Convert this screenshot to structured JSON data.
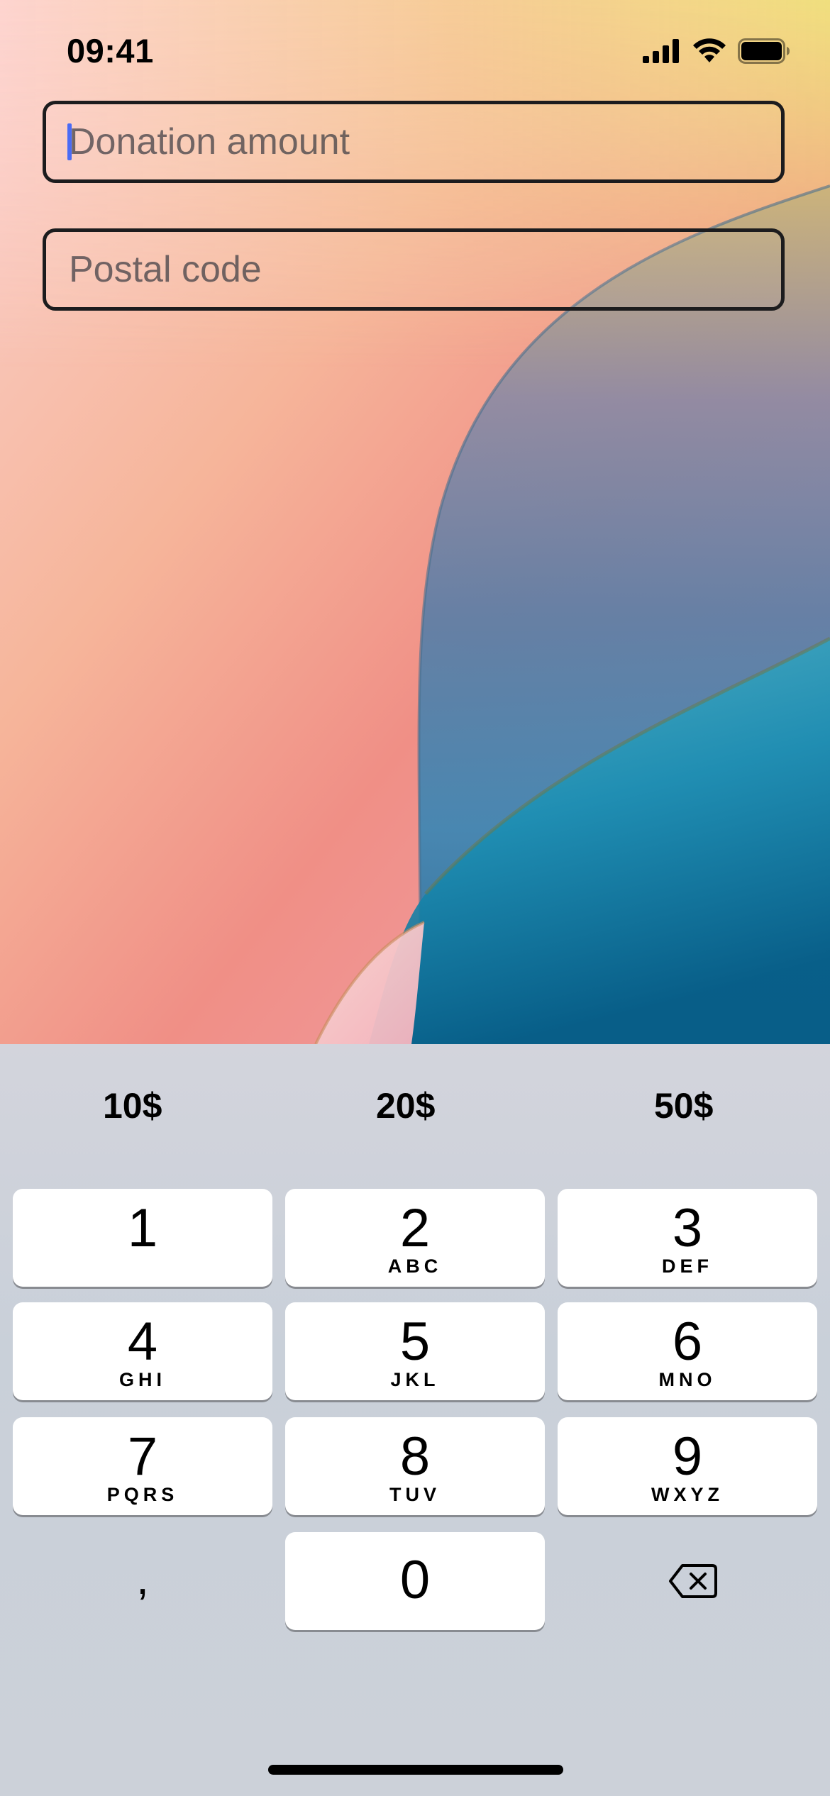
{
  "status_bar": {
    "time": "09:41"
  },
  "form": {
    "amount_placeholder": "Donation amount",
    "postal_placeholder": "Postal code"
  },
  "suggestions": [
    "10$",
    "20$",
    "50$"
  ],
  "keypad": {
    "keys": [
      {
        "digit": "1",
        "letters": ""
      },
      {
        "digit": "2",
        "letters": "ABC"
      },
      {
        "digit": "3",
        "letters": "DEF"
      },
      {
        "digit": "4",
        "letters": "GHI"
      },
      {
        "digit": "5",
        "letters": "JKL"
      },
      {
        "digit": "6",
        "letters": "MNO"
      },
      {
        "digit": "7",
        "letters": "PQRS"
      },
      {
        "digit": "8",
        "letters": "TUV"
      },
      {
        "digit": "9",
        "letters": "WXYZ"
      },
      {
        "digit": "0",
        "letters": ""
      }
    ],
    "decimal_key": ",",
    "delete_icon": "delete-backspace-icon"
  },
  "colors": {
    "caret": "#4b6bf5",
    "field_border": "#1c1c1e",
    "key_background": "#ffffff",
    "keyboard_background": "#cdd2da"
  }
}
